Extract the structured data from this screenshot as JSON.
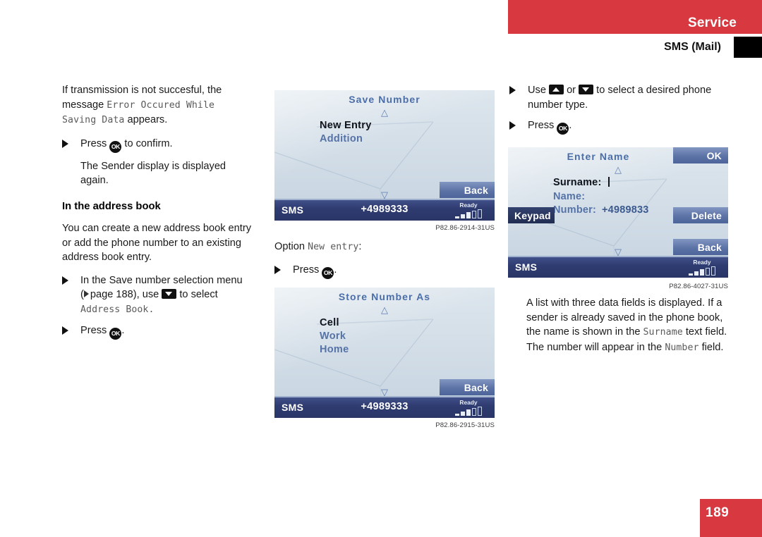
{
  "header": {
    "section_label": "Service",
    "subtitle": "SMS (Mail)"
  },
  "footer": {
    "page_number": "189"
  },
  "left_column": {
    "paragraph_1_pre": "If transmission is not succesful, the message ",
    "paragraph_1_mono": "Error Occured While Saving Data",
    "paragraph_1_post": " appears.",
    "bullet_1_pre": "Press ",
    "bullet_1_key": "OK",
    "bullet_1_post": " to confirm.",
    "sub_text_1": "The Sender display is displayed again.",
    "section_heading": "In the address book",
    "paragraph_2": "You can create a new address book entry or add the phone number to an existing address book entry.",
    "bullet_2_line1": "In the Save number selection menu",
    "bullet_2_ref_pre": "(",
    "bullet_2_ref": "page 188",
    "bullet_2_ref_post": "), use ",
    "bullet_2_after_key": " to select",
    "bullet_2_mono": "Address Book.",
    "bullet_3_pre": "Press ",
    "bullet_3_key": "OK",
    "bullet_3_post": "."
  },
  "screen_save_number": {
    "title": "Save Number",
    "up_arrow": "△",
    "down_arrow": "▽",
    "items": [
      {
        "label": "New Entry",
        "selected": true
      },
      {
        "label": "Addition",
        "selected": false
      }
    ],
    "back_button": "Back",
    "status_label": "SMS",
    "status_number": "+4989333",
    "status_ready": "Ready",
    "caption": "P82.86-2914-31US"
  },
  "middle_column": {
    "option_label": "Option ",
    "option_mono": "New entry",
    "option_colon": ":",
    "bullet_pre": "Press ",
    "bullet_key": "OK",
    "bullet_post": "."
  },
  "screen_store_number_as": {
    "title": "Store Number As",
    "up_arrow": "△",
    "down_arrow": "▽",
    "items": [
      {
        "label": "Cell",
        "selected": true
      },
      {
        "label": "Work",
        "selected": false
      },
      {
        "label": "Home",
        "selected": false
      }
    ],
    "back_button": "Back",
    "status_label": "SMS",
    "status_number": "+4989333",
    "status_ready": "Ready",
    "caption": "P82.86-2915-31US"
  },
  "right_column": {
    "bullet_1_pre": "Use ",
    "bullet_1_or": " or ",
    "bullet_1_post": " to select a desired phone number type.",
    "bullet_2_pre": "Press ",
    "bullet_2_key": "OK",
    "bullet_2_post": ".",
    "paragraph_pre": "A list with three data fields is displayed. If a sender is already saved in the phone book, the name is shown in the ",
    "paragraph_mono_1": "Surname",
    "paragraph_mid": " text field. The number will appear in the ",
    "paragraph_mono_2": "Number",
    "paragraph_post": " field."
  },
  "screen_enter_name": {
    "title": "Enter Name",
    "up_arrow": "△",
    "down_arrow": "▽",
    "ok_button": "OK",
    "keypad_button": "Keypad",
    "delete_button": "Delete",
    "back_button": "Back",
    "fields": [
      {
        "label": "Surname:",
        "value": "",
        "selected": true
      },
      {
        "label": "Name:",
        "value": "",
        "selected": false
      },
      {
        "label": "Number:",
        "value": "+4989833",
        "selected": false
      }
    ],
    "status_label": "SMS",
    "status_ready": "Ready",
    "caption": "P82.86-4027-31US"
  },
  "colors": {
    "brand_red": "#d8383f",
    "screen_blue": "#5573a6",
    "status_navy": "#2f3c71",
    "button_blue": "#5c73a6"
  }
}
